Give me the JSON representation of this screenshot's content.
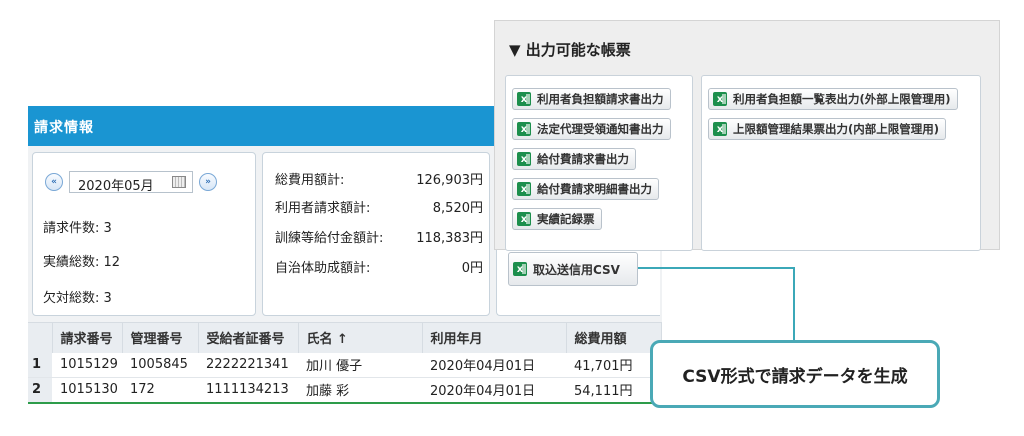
{
  "header": {
    "title": "請求情報"
  },
  "period": {
    "prev_icon": "chevron-double-left-icon",
    "next_icon": "chevron-double-right-icon",
    "month": "2020年05月",
    "prev_glyph": "«",
    "next_glyph": "»"
  },
  "stats": [
    {
      "label": "請求件数: 3"
    },
    {
      "label": "実績総数: 12"
    },
    {
      "label": "欠対総数: 3"
    }
  ],
  "summary": [
    {
      "label": "総費用額計:",
      "value": "126,903円"
    },
    {
      "label": "利用者請求額計:",
      "value": "8,520円"
    },
    {
      "label": "訓練等給付金額計:",
      "value": "118,383円"
    },
    {
      "label": "自治体助成額計:",
      "value": "0円"
    }
  ],
  "popup": {
    "title": "▼ 出力可能な帳票",
    "left_buttons": [
      "利用者負担額請求書出力",
      "法定代理受領通知書出力",
      "給付費請求書出力",
      "給付費請求明細書出力",
      "実績記録票"
    ],
    "right_buttons": [
      "利用者負担額一覧表出力(外部上限管理用)",
      "上限額管理結果票出力(内部上限管理用)"
    ]
  },
  "csv_button": {
    "label": "取込送信用CSV"
  },
  "callout": {
    "text": "CSV形式で請求データを生成"
  },
  "table": {
    "columns": [
      "請求番号",
      "管理番号",
      "受給者証番号",
      "氏名 ↑",
      "利用年月",
      "総費用額"
    ],
    "rows": [
      {
        "index": "1",
        "cells": [
          "1015129",
          "1005845",
          "2222221341",
          "加川 優子",
          "2020年04月01日",
          "41,701円"
        ]
      },
      {
        "index": "2",
        "cells": [
          "1015130",
          "172",
          "1111134213",
          "加藤 彩",
          "2020年04月01日",
          "54,111円"
        ]
      }
    ]
  },
  "colors": {
    "header_bg": "#1a95d2",
    "callout_border": "#4aa9b6",
    "excel_green": "#1d8f4d"
  }
}
